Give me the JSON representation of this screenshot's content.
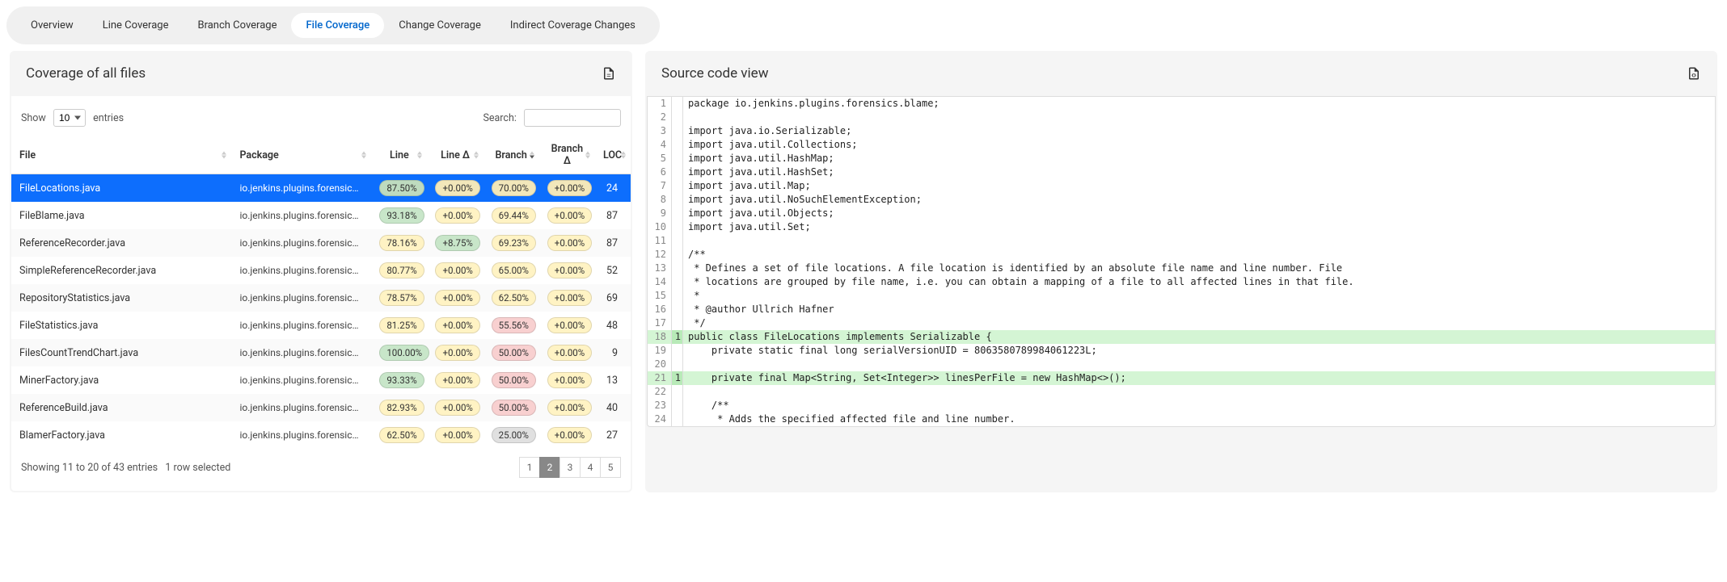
{
  "tabs": [
    "Overview",
    "Line Coverage",
    "Branch Coverage",
    "File Coverage",
    "Change Coverage",
    "Indirect Coverage Changes"
  ],
  "active_tab": 3,
  "left": {
    "title": "Coverage of all files",
    "show_label": "Show",
    "entries_label": "entries",
    "entries_value": "10",
    "search_label": "Search:",
    "columns": [
      "File",
      "Package",
      "Line",
      "Line Δ",
      "Branch",
      "Branch Δ",
      "LOC"
    ],
    "rows": [
      {
        "file": "FileLocations.java",
        "pkg": "io.jenkins.plugins.forensics.blame",
        "line": "87.50%",
        "line_c": "green",
        "lined": "+0.00%",
        "lined_c": "yellow",
        "branch": "70.00%",
        "branch_c": "yellow",
        "branchd": "+0.00%",
        "branchd_c": "yellow",
        "loc": "24",
        "sel": true
      },
      {
        "file": "FileBlame.java",
        "pkg": "io.jenkins.plugins.forensics.blame",
        "line": "93.18%",
        "line_c": "green",
        "lined": "+0.00%",
        "lined_c": "yellow",
        "branch": "69.44%",
        "branch_c": "yellow",
        "branchd": "+0.00%",
        "branchd_c": "yellow",
        "loc": "87"
      },
      {
        "file": "ReferenceRecorder.java",
        "pkg": "io.jenkins.plugins.forensics.reference",
        "line": "78.16%",
        "line_c": "yellow",
        "lined": "+8.75%",
        "lined_c": "green",
        "branch": "69.23%",
        "branch_c": "yellow",
        "branchd": "+0.00%",
        "branchd_c": "yellow",
        "loc": "87"
      },
      {
        "file": "SimpleReferenceRecorder.java",
        "pkg": "io.jenkins.plugins.forensics.reference",
        "line": "80.77%",
        "line_c": "yellow",
        "lined": "+0.00%",
        "lined_c": "yellow",
        "branch": "65.00%",
        "branch_c": "yellow",
        "branchd": "+0.00%",
        "branchd_c": "yellow",
        "loc": "52"
      },
      {
        "file": "RepositoryStatistics.java",
        "pkg": "io.jenkins.plugins.forensics.miner",
        "line": "78.57%",
        "line_c": "yellow",
        "lined": "+0.00%",
        "lined_c": "yellow",
        "branch": "62.50%",
        "branch_c": "yellow",
        "branchd": "+0.00%",
        "branchd_c": "yellow",
        "loc": "69"
      },
      {
        "file": "FileStatistics.java",
        "pkg": "io.jenkins.plugins.forensics.miner",
        "line": "81.25%",
        "line_c": "yellow",
        "lined": "+0.00%",
        "lined_c": "yellow",
        "branch": "55.56%",
        "branch_c": "red",
        "branchd": "+0.00%",
        "branchd_c": "yellow",
        "loc": "48"
      },
      {
        "file": "FilesCountTrendChart.java",
        "pkg": "io.jenkins.plugins.forensics.miner",
        "line": "100.00%",
        "line_c": "green",
        "lined": "+0.00%",
        "lined_c": "yellow",
        "branch": "50.00%",
        "branch_c": "red",
        "branchd": "+0.00%",
        "branchd_c": "yellow",
        "loc": "9"
      },
      {
        "file": "MinerFactory.java",
        "pkg": "io.jenkins.plugins.forensics.miner",
        "line": "93.33%",
        "line_c": "green",
        "lined": "+0.00%",
        "lined_c": "yellow",
        "branch": "50.00%",
        "branch_c": "red",
        "branchd": "+0.00%",
        "branchd_c": "yellow",
        "loc": "13"
      },
      {
        "file": "ReferenceBuild.java",
        "pkg": "io.jenkins.plugins.forensics.reference",
        "line": "82.93%",
        "line_c": "yellow",
        "lined": "+0.00%",
        "lined_c": "yellow",
        "branch": "50.00%",
        "branch_c": "red",
        "branchd": "+0.00%",
        "branchd_c": "yellow",
        "loc": "40"
      },
      {
        "file": "BlamerFactory.java",
        "pkg": "io.jenkins.plugins.forensics.blame",
        "line": "62.50%",
        "line_c": "yellow",
        "lined": "+0.00%",
        "lined_c": "yellow",
        "branch": "25.00%",
        "branch_c": "gray",
        "branchd": "+0.00%",
        "branchd_c": "yellow",
        "loc": "27"
      }
    ],
    "footer_info": "Showing 11 to 20 of 43 entries",
    "footer_sel": "1 row selected",
    "pages": [
      "1",
      "2",
      "3",
      "4",
      "5"
    ],
    "active_page": 1
  },
  "right": {
    "title": "Source code view",
    "lines": [
      {
        "n": 1,
        "t": "package io.jenkins.plugins.forensics.blame;"
      },
      {
        "n": 2,
        "t": ""
      },
      {
        "n": 3,
        "t": "import java.io.Serializable;"
      },
      {
        "n": 4,
        "t": "import java.util.Collections;"
      },
      {
        "n": 5,
        "t": "import java.util.HashMap;"
      },
      {
        "n": 6,
        "t": "import java.util.HashSet;"
      },
      {
        "n": 7,
        "t": "import java.util.Map;"
      },
      {
        "n": 8,
        "t": "import java.util.NoSuchElementException;"
      },
      {
        "n": 9,
        "t": "import java.util.Objects;"
      },
      {
        "n": 10,
        "t": "import java.util.Set;"
      },
      {
        "n": 11,
        "t": ""
      },
      {
        "n": 12,
        "t": "/**"
      },
      {
        "n": 13,
        "t": " * Defines a set of file locations. A file location is identified by an absolute file name and line number. File"
      },
      {
        "n": 14,
        "t": " * locations are grouped by file name, i.e. you can obtain a mapping of a file to all affected lines in that file."
      },
      {
        "n": 15,
        "t": " *"
      },
      {
        "n": 16,
        "t": " * @author Ullrich Hafner"
      },
      {
        "n": 17,
        "t": " */"
      },
      {
        "n": 18,
        "t": "public class FileLocations implements Serializable {",
        "cov": true,
        "h": "1"
      },
      {
        "n": 19,
        "t": "    private static final long serialVersionUID = 8063580789984061223L;"
      },
      {
        "n": 20,
        "t": ""
      },
      {
        "n": 21,
        "t": "    private final Map<String, Set<Integer>> linesPerFile = new HashMap<>();",
        "cov": true,
        "h": "1"
      },
      {
        "n": 22,
        "t": ""
      },
      {
        "n": 23,
        "t": "    /**"
      },
      {
        "n": 24,
        "t": "     * Adds the specified affected file and line number."
      }
    ]
  }
}
